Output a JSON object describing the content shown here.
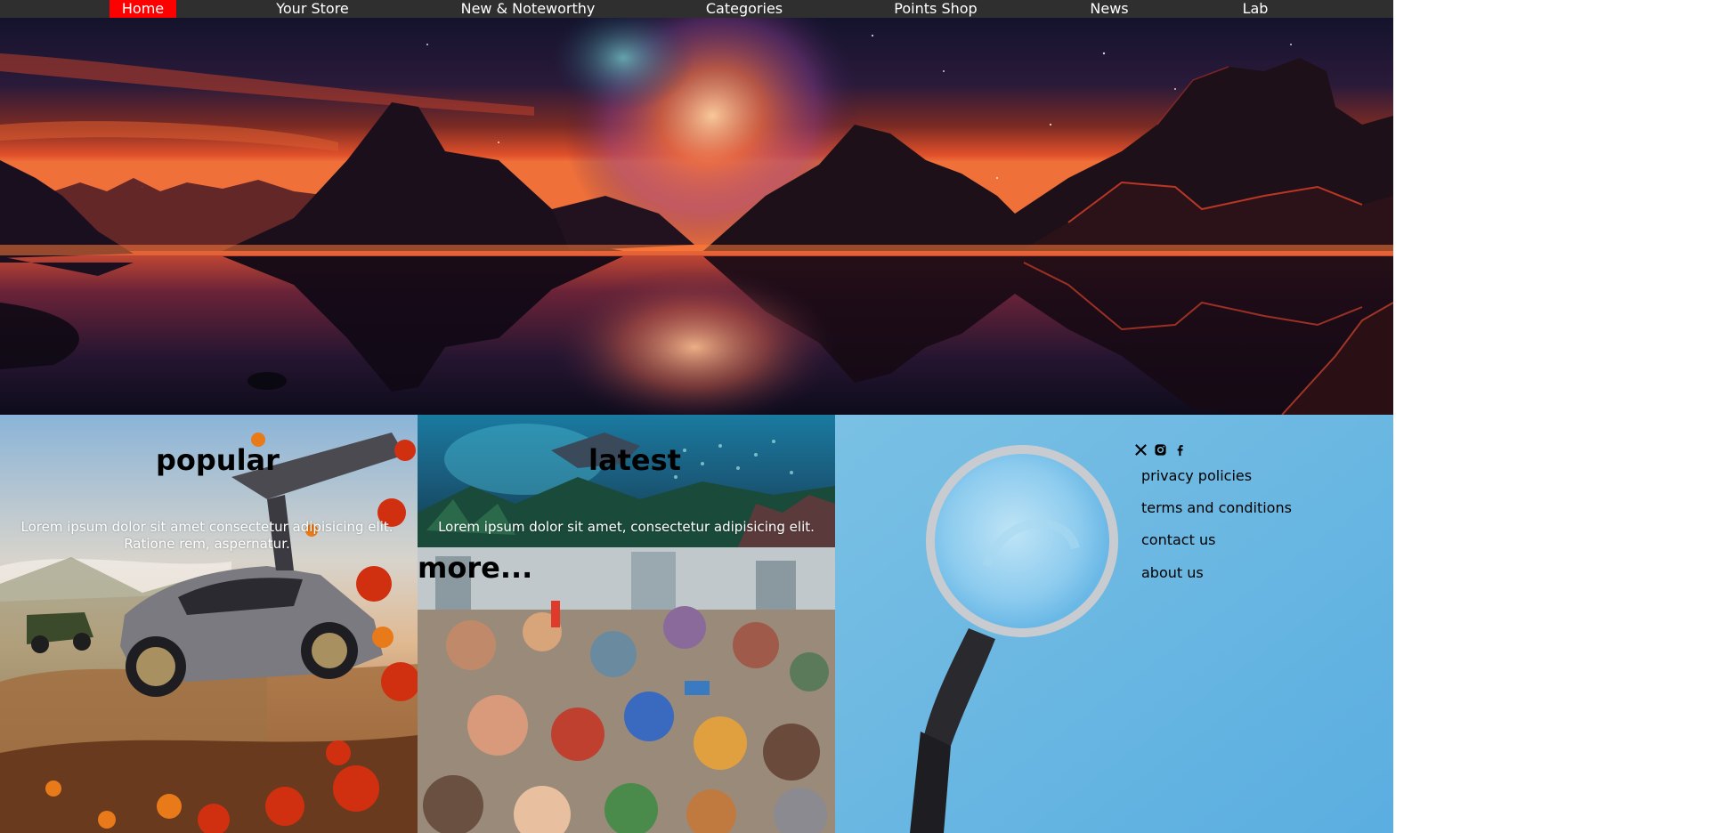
{
  "nav": {
    "items": [
      {
        "label": "Home",
        "active": true
      },
      {
        "label": "Your Store",
        "active": false
      },
      {
        "label": "New & Noteworthy",
        "active": false
      },
      {
        "label": "Categories",
        "active": false
      },
      {
        "label": "Points Shop",
        "active": false
      },
      {
        "label": "News",
        "active": false
      },
      {
        "label": "Lab",
        "active": false
      }
    ],
    "active_color": "#ff0000",
    "bar_color": "#2f2f2f"
  },
  "tiles": {
    "popular": {
      "title": "popular",
      "text": "Lorem ipsum dolor sit amet consectetur adipisicing elit. Ratione rem, aspernatur."
    },
    "latest": {
      "title": "latest",
      "text": "Lorem ipsum dolor sit amet, consectetur adipisicing elit."
    },
    "more": {
      "title": "more..."
    }
  },
  "footer": {
    "social": [
      {
        "icon": "x-twitter-icon"
      },
      {
        "icon": "instagram-icon"
      },
      {
        "icon": "facebook-icon"
      }
    ],
    "links": [
      {
        "label": "privacy policies"
      },
      {
        "label": "terms and conditions"
      },
      {
        "label": "contact us"
      },
      {
        "label": "about us"
      }
    ]
  }
}
